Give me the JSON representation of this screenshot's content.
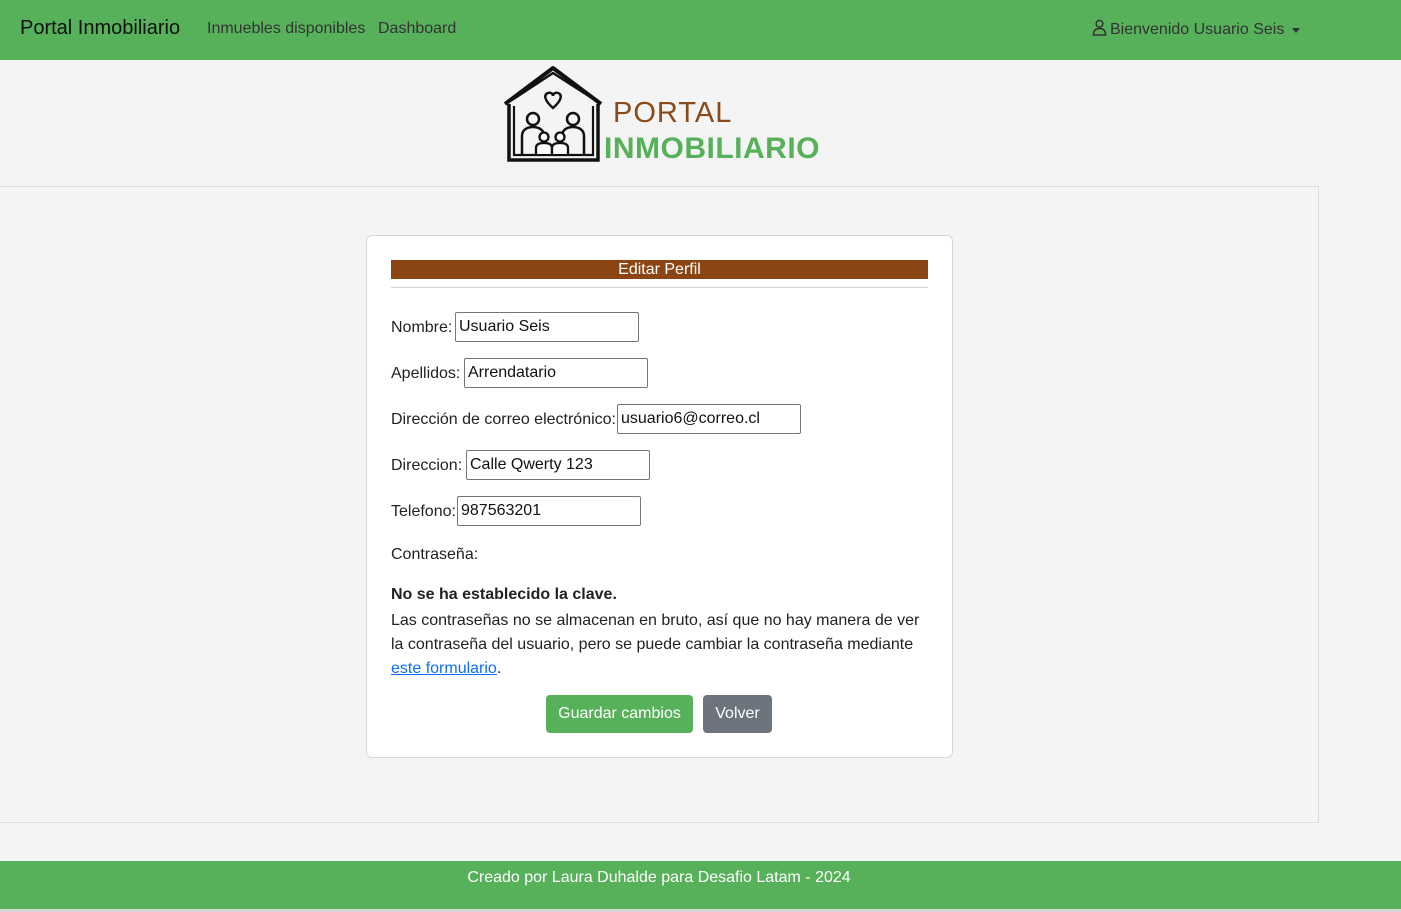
{
  "navbar": {
    "brand": "Portal Inmobiliario",
    "links": [
      "Inmuebles disponibles",
      "Dashboard"
    ],
    "user_menu": "Bienvenido Usuario Seis"
  },
  "logo": {
    "line1": "PORTAL",
    "line2": "INMOBILIARIO"
  },
  "form": {
    "title": "Editar Perfil",
    "fields": [
      {
        "label": "Nombre:",
        "value": "Usuario Seis"
      },
      {
        "label": "Apellidos:",
        "value": "Arrendatario"
      },
      {
        "label": "Dirección de correo electrónico:",
        "value": "usuario6@correo.cl"
      },
      {
        "label": "Direccion:",
        "value": "Calle Qwerty 123"
      },
      {
        "label": "Telefono:",
        "value": "987563201"
      }
    ],
    "password_label": "Contraseña:",
    "password_status": "No se ha establecido la clave.",
    "password_help": "Las contraseñas no se almacenan en bruto, así que no hay manera de ver la contraseña del usuario, pero se puede cambiar la contraseña mediante",
    "password_link": "este formulario",
    "password_help_end": ".",
    "save_button": "Guardar cambios",
    "back_button": "Volver"
  },
  "footer": {
    "text": "Creado por Laura Duhalde para Desafio Latam - 2024"
  },
  "colors": {
    "primary_green": "#57b15b",
    "brown": "#8b4513",
    "secondary_gray": "#6c757d",
    "link_blue": "#0d6efd"
  }
}
